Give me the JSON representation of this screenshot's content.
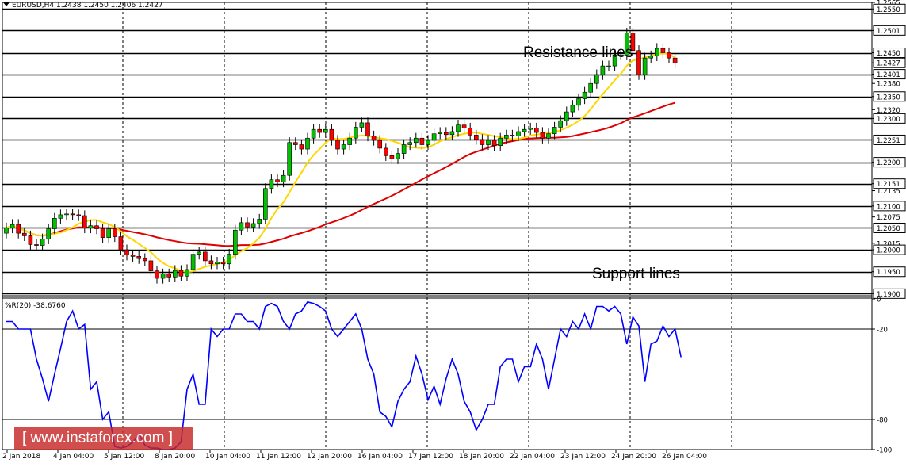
{
  "header": {
    "symbol_info": "EURUSD,H4  1.2438 1.2450 1.2406 1.2427"
  },
  "indicator_label": "%R(20) -38.6760",
  "watermark": "[ www.instaforex.com ]",
  "annotations": {
    "resistance": "Resistance lines",
    "support": "Support lines"
  },
  "colors": {
    "bull": "#00c000",
    "bear": "#ff0000",
    "ma_fast": "#ffd700",
    "ma_slow": "#e00000",
    "wr_line": "#0000ff",
    "hline": "#000000",
    "grid": "#000000",
    "watermark_bg": "#c62828"
  },
  "chart_data": [
    {
      "type": "candlestick",
      "timeframe": "H4",
      "ylim": [
        1.1897,
        1.2565
      ],
      "y_ticks": [
        "1.2565",
        "1.2550",
        "1.2501",
        "1.2450",
        "1.2427",
        "1.2401",
        "1.2380",
        "1.2350",
        "1.2320",
        "1.2300",
        "1.2251",
        "1.2200",
        "1.2151",
        "1.2135",
        "1.2100",
        "1.2075",
        "1.2050",
        "1.2015",
        "1.2000",
        "1.1950",
        "1.1900"
      ],
      "y_tick_values": [
        1.2565,
        1.255,
        1.2501,
        1.245,
        1.2427,
        1.2401,
        1.238,
        1.235,
        1.232,
        1.23,
        1.2251,
        1.22,
        1.2151,
        1.2135,
        1.21,
        1.2075,
        1.205,
        1.2015,
        1.2,
        1.195,
        1.19
      ],
      "boxed_ticks": [
        "1.2550",
        "1.2501",
        "1.2450",
        "1.2427",
        "1.2401",
        "1.2350",
        "1.2300",
        "1.2251",
        "1.2200",
        "1.2151",
        "1.2100",
        "1.2050",
        "1.2000",
        "1.1950",
        "1.1900"
      ],
      "horizontal_lines": [
        1.255,
        1.2501,
        1.245,
        1.2401,
        1.235,
        1.23,
        1.2251,
        1.22,
        1.2151,
        1.21,
        1.205,
        1.2,
        1.195,
        1.19
      ],
      "x_labels": [
        "2 Jan 2018",
        "4 Jan 04:00",
        "5 Jan 12:00",
        "8 Jan 20:00",
        "10 Jan 04:00",
        "11 Jan 12:00",
        "12 Jan 20:00",
        "16 Jan 04:00",
        "17 Jan 12:00",
        "18 Jan 20:00",
        "22 Jan 04:00",
        "23 Jan 12:00",
        "24 Jan 20:00",
        "26 Jan 04:00"
      ],
      "vertical_grid_after_label": [
        1,
        3,
        5,
        7,
        9,
        11,
        13
      ],
      "closes": [
        1.205,
        1.2058,
        1.2038,
        1.2032,
        1.2012,
        1.201,
        1.2025,
        1.2048,
        1.2072,
        1.208,
        1.2082,
        1.208,
        1.2078,
        1.205,
        1.2055,
        1.2048,
        1.2028,
        1.2048,
        1.203,
        1.2,
        1.1988,
        1.1985,
        1.198,
        1.1975,
        1.1952,
        1.1935,
        1.1945,
        1.1938,
        1.1953,
        1.194,
        1.1955,
        1.199,
        1.1995,
        1.1975,
        1.1968,
        1.1972,
        1.1968,
        1.199,
        1.2045,
        1.2062,
        1.2052,
        1.206,
        1.207,
        1.214,
        1.216,
        1.2155,
        1.217,
        1.2245,
        1.224,
        1.223,
        1.2255,
        1.2275,
        1.2268,
        1.2275,
        1.225,
        1.223,
        1.224,
        1.2255,
        1.228,
        1.229,
        1.226,
        1.225,
        1.2232,
        1.2215,
        1.2208,
        1.222,
        1.224,
        1.2245,
        1.2255,
        1.224,
        1.225,
        1.2265,
        1.2268,
        1.2263,
        1.227,
        1.2285,
        1.2278,
        1.2262,
        1.2252,
        1.224,
        1.225,
        1.2238,
        1.2255,
        1.2262,
        1.226,
        1.227,
        1.2275,
        1.2278,
        1.2268,
        1.2255,
        1.2265,
        1.228,
        1.2295,
        1.2315,
        1.233,
        1.2345,
        1.236,
        1.238,
        1.24,
        1.242,
        1.242,
        1.2445,
        1.2445,
        1.2495,
        1.2455,
        1.24,
        1.2438,
        1.2443,
        1.246,
        1.245,
        1.2438,
        1.2427
      ],
      "indicator": {
        "name": "%R(20)",
        "ylim": [
          -100,
          0
        ],
        "levels": [
          -20,
          -80
        ],
        "y_ticks": [
          "0",
          "-20",
          "-80",
          "-100"
        ],
        "y_tick_values": [
          0,
          -20,
          -80,
          -100
        ],
        "values": [
          -15,
          -15,
          -20,
          -20,
          -20,
          -40,
          -53,
          -68,
          -50,
          -33,
          -15,
          -8,
          -20,
          -17,
          -60,
          -55,
          -80,
          -75,
          -98,
          -99,
          -98,
          -95,
          -90,
          -97,
          -99,
          -99,
          -100,
          -100,
          -99,
          -95,
          -60,
          -50,
          -70,
          -70,
          -20,
          -25,
          -20,
          -20,
          -10,
          -10,
          -15,
          -15,
          -20,
          -5,
          -3,
          -5,
          -15,
          -20,
          -10,
          -8,
          -2,
          -3,
          -5,
          -8,
          -20,
          -25,
          -20,
          -15,
          -10,
          -20,
          -40,
          -50,
          -75,
          -78,
          -85,
          -68,
          -60,
          -55,
          -38,
          -50,
          -67,
          -58,
          -70,
          -53,
          -40,
          -50,
          -68,
          -75,
          -87,
          -80,
          -70,
          -70,
          -45,
          -40,
          -40,
          -55,
          -45,
          -45,
          -30,
          -40,
          -60,
          -40,
          -20,
          -25,
          -15,
          -20,
          -10,
          -20,
          -5,
          -5,
          -8,
          -5,
          -10,
          -30,
          -12,
          -18,
          -55,
          -30,
          -28,
          -18,
          -25,
          -20,
          -38.676
        ]
      }
    }
  ]
}
